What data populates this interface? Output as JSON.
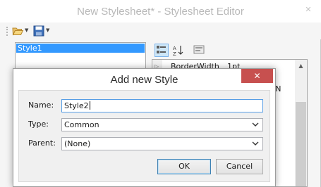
{
  "editor": {
    "title": "New Stylesheet* - Stylesheet Editor",
    "toolbar": {
      "open_icon": "open-folder-icon",
      "save_icon": "save-disk-icon"
    },
    "styles": [
      "Style1"
    ],
    "property_toolbar": {
      "categorized_icon": "categorized-view-icon",
      "alphabetical_icon": "sort-az-icon",
      "pages_icon": "property-pages-icon"
    },
    "properties": [
      {
        "name": "BorderWidth",
        "value": "1pt"
      },
      {
        "name": "",
        "value": "pt, N"
      }
    ]
  },
  "dialog": {
    "title": "Add new Style",
    "close_glyph": "✕",
    "fields": {
      "name_label": "Name:",
      "name_value": "Style2",
      "type_label": "Type:",
      "type_value": "Common",
      "parent_label": "Parent:",
      "parent_value": "(None)"
    },
    "buttons": {
      "ok": "OK",
      "cancel": "Cancel"
    }
  },
  "colors": {
    "selection": "#3399ff",
    "close_button": "#c7504f",
    "focus_border": "#569de5"
  }
}
